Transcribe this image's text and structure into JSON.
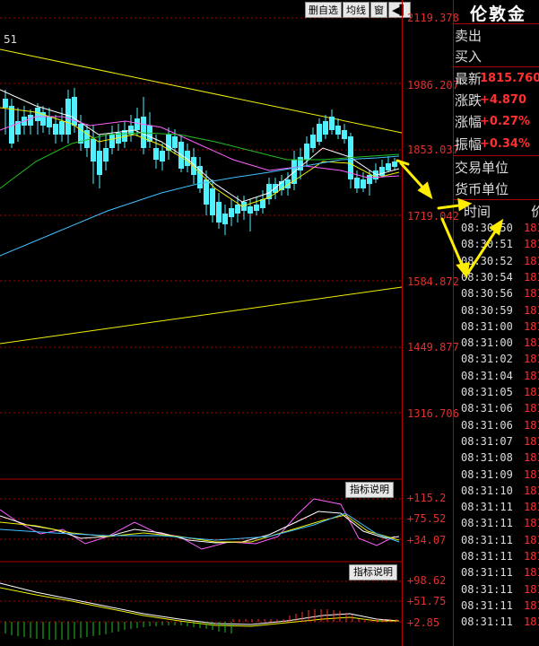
{
  "toolbar": {
    "btn_delete_self": "删自选",
    "btn_ma": "均线",
    "btn_window": "窗",
    "btn_arrow": "◀▌"
  },
  "chart": {
    "corner_label": "51",
    "price_axis": [
      "2119.378",
      "1986.207",
      "1853.037",
      "1719.042",
      "1584.872",
      "1449.877",
      "1316.706"
    ],
    "indicator1_axis": [
      "+115.2",
      "+75.52",
      "+34.07"
    ],
    "indicator2_axis": [
      "+98.62",
      "+51.75",
      "+2.85"
    ],
    "indicator_btn1": "指标说明",
    "indicator_btn2": "指标说明"
  },
  "quote": {
    "title": "伦敦金",
    "rows": [
      {
        "label": "卖出",
        "value": ""
      },
      {
        "label": "买入",
        "value": ""
      },
      {
        "label": "最新",
        "value": "1815.760"
      },
      {
        "label": "涨跌",
        "value": "+4.870"
      },
      {
        "label": "涨幅",
        "value": "+0.27%"
      },
      {
        "label": "振幅",
        "value": "+0.34%"
      },
      {
        "label": "交易单位",
        "value": ""
      },
      {
        "label": "货币单位",
        "value": ""
      }
    ],
    "ticks_header_time": "时间",
    "ticks_header_price": "价",
    "ticks": [
      "08:30:50",
      "08:30:51",
      "08:30:52",
      "08:30:54",
      "08:30:56",
      "08:30:59",
      "08:31:00",
      "08:31:00",
      "08:31:02",
      "08:31:04",
      "08:31:05",
      "08:31:06",
      "08:31:06",
      "08:31:07",
      "08:31:08",
      "08:31:09",
      "08:31:10",
      "08:31:11",
      "08:31:11",
      "08:31:11",
      "08:31:11",
      "08:31:11",
      "08:31:11",
      "08:31:11",
      "08:31:11"
    ],
    "tick_price_prefix": "181"
  },
  "colors": {
    "up": "#ff3030",
    "down": "#4ff0ff",
    "grid": "#b00000",
    "ma_white": "#ffffff",
    "ma_yellow": "#f0f000",
    "ma_magenta": "#ff60ff",
    "ma_green": "#20c020",
    "ma_cyan": "#40c0ff"
  }
}
